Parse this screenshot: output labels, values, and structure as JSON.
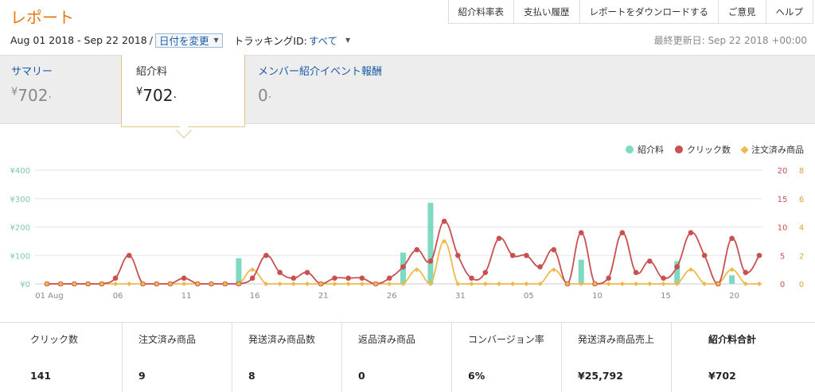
{
  "header": {
    "title": "レポート"
  },
  "topnav": [
    "紹介料率表",
    "支払い履歴",
    "レポートをダウンロードする",
    "ご意見",
    "ヘルプ"
  ],
  "filters": {
    "date_range": "Aug 01 2018 - Sep 22 2018",
    "separator": "/",
    "change_date": "日付を変更",
    "tracking_label": "トラッキングID:",
    "tracking_value": "すべて"
  },
  "last_updated": "最終更新日: Sep 22 2018 +00:00",
  "tabs": [
    {
      "label": "サマリー",
      "value": "702"
    },
    {
      "label": "紹介料",
      "value": "702"
    },
    {
      "label": "メンバー紹介イベント報酬",
      "value": "0"
    }
  ],
  "currency_symbol": "¥",
  "legend": [
    {
      "name": "紹介料",
      "color": "#7dd9c0"
    },
    {
      "name": "クリック数",
      "color": "#c8504f"
    },
    {
      "name": "注文済み商品",
      "color": "#edb94c"
    }
  ],
  "chart_data": {
    "type": "bar",
    "x_tick_labels": [
      "01 Aug",
      "06",
      "11",
      "16",
      "21",
      "26",
      "31",
      "05",
      "10",
      "15",
      "20"
    ],
    "x_tick_indices": [
      0,
      5,
      10,
      15,
      20,
      25,
      30,
      35,
      40,
      45,
      50
    ],
    "num_days": 53,
    "y_left": {
      "ticks": [
        "¥0",
        "¥100",
        "¥200",
        "¥300",
        "¥400"
      ],
      "range": [
        0,
        400
      ]
    },
    "y_right_clicks": {
      "ticks": [
        "0",
        "5",
        "10",
        "15",
        "20"
      ],
      "range": [
        0,
        20
      ]
    },
    "y_right_orders": {
      "ticks": [
        "0",
        "2",
        "4",
        "6",
        "8"
      ],
      "range": [
        0,
        8
      ]
    },
    "series": [
      {
        "name": "紹介料",
        "kind": "bar",
        "values": [
          0,
          0,
          0,
          0,
          0,
          0,
          0,
          0,
          0,
          0,
          0,
          0,
          0,
          0,
          90,
          0,
          0,
          0,
          0,
          0,
          0,
          0,
          0,
          0,
          0,
          0,
          110,
          0,
          285,
          0,
          0,
          0,
          0,
          0,
          0,
          0,
          0,
          0,
          0,
          85,
          0,
          0,
          0,
          0,
          0,
          0,
          80,
          0,
          0,
          0,
          30,
          0,
          0
        ]
      },
      {
        "name": "クリック数",
        "kind": "line",
        "values": [
          0,
          0,
          0,
          0,
          0,
          1,
          5,
          0,
          0,
          0,
          1,
          0,
          0,
          0,
          0,
          1,
          5,
          2,
          1,
          2,
          0,
          1,
          1,
          1,
          0,
          1,
          3,
          6,
          4,
          11,
          5,
          1,
          2,
          8,
          5,
          5,
          3,
          6,
          0,
          9,
          0,
          1,
          9,
          2,
          4,
          1,
          3,
          9,
          5,
          0,
          8,
          2,
          5
        ]
      },
      {
        "name": "注文済み商品",
        "kind": "line",
        "values": [
          0,
          0,
          0,
          0,
          0,
          0,
          0,
          0,
          0,
          0,
          0,
          0,
          0,
          0,
          0,
          1,
          0,
          0,
          0,
          0,
          0,
          0,
          0,
          0,
          0,
          0,
          0,
          1,
          0,
          3,
          0,
          0,
          0,
          0,
          0,
          0,
          0,
          1,
          0,
          0,
          0,
          0,
          0,
          0,
          0,
          0,
          0,
          1,
          0,
          0,
          1,
          0,
          0
        ]
      }
    ]
  },
  "metrics": [
    {
      "label": "クリック数",
      "value": "141"
    },
    {
      "label": "注文済み商品",
      "value": "9"
    },
    {
      "label": "発送済み商品数",
      "value": "8"
    },
    {
      "label": "返品済み商品",
      "value": "0"
    },
    {
      "label": "コンバージョン率",
      "value": "6%"
    },
    {
      "label": "発送済み商品売上",
      "value": "¥25,792"
    },
    {
      "label": "紹介料合計",
      "value": "¥702"
    }
  ]
}
